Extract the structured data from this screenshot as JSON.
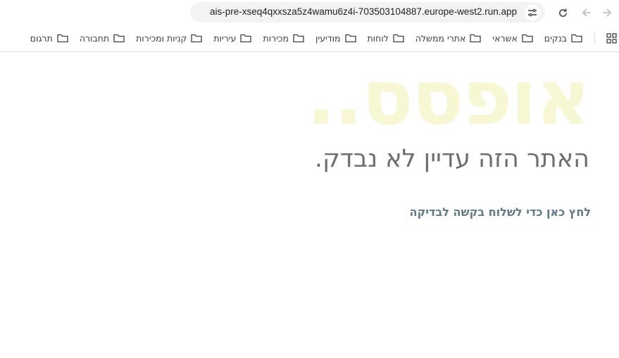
{
  "browser": {
    "url": "ais-pre-xseq4qxxsza5z4wamu6z4i-703503104887.europe-west2.run.app"
  },
  "bookmarks": [
    {
      "label": "בנקים"
    },
    {
      "label": "אשראי"
    },
    {
      "label": "אתרי ממשלה"
    },
    {
      "label": "לוחות"
    },
    {
      "label": "מודיעין"
    },
    {
      "label": "מכירות"
    },
    {
      "label": "עיריות"
    },
    {
      "label": "קניות ומכירות"
    },
    {
      "label": "תחבורה"
    },
    {
      "label": "תרגום"
    }
  ],
  "page": {
    "oops": "אופסס..",
    "subtitle": "האתר הזה עדיין לא נבדק.",
    "request_link": "לחץ כאן כדי לשלוח בקשה לבדיקה"
  },
  "colors": {
    "oops": "#f8f7d4",
    "subtitle": "#6e6e6e",
    "link": "#5f7a85"
  }
}
